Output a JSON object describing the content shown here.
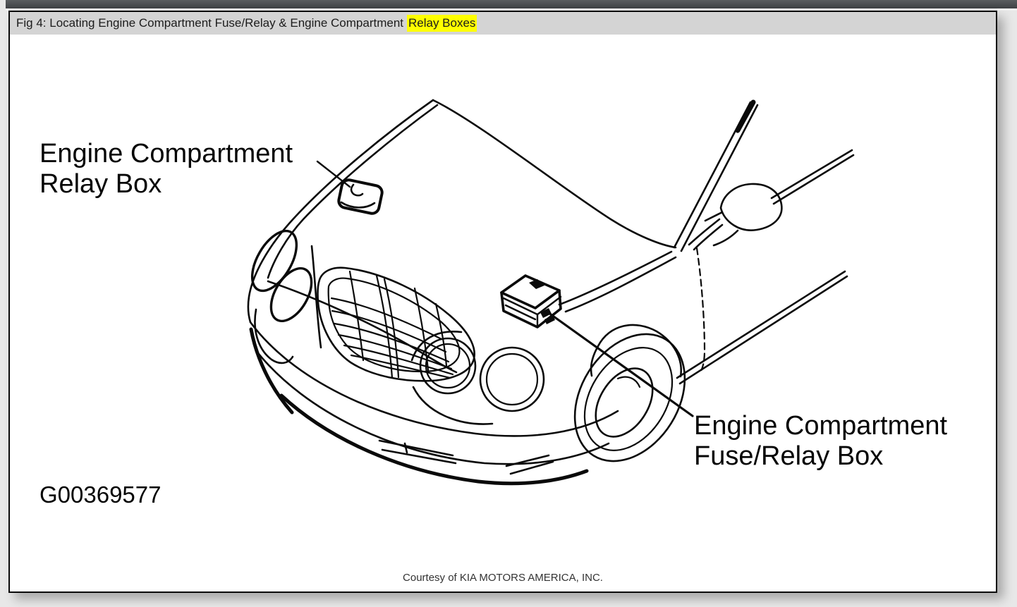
{
  "title_bar": {
    "prefix": "Fig 4: Locating Engine Compartment Fuse/Relay & Engine Compartment",
    "highlight": "Relay Boxes",
    "highlight_color": "#ffff00"
  },
  "figure": {
    "callouts": {
      "relay_box": {
        "line1": "Engine Compartment",
        "line2": "Relay Box"
      },
      "fuse_relay_box": {
        "line1": "Engine Compartment",
        "line2": "Fuse/Relay Box"
      }
    },
    "figure_id": "G00369577",
    "courtesy": "Courtesy of KIA MOTORS AMERICA, INC.",
    "ink_color": "#0a0a0a",
    "paper_color": "#ffffff"
  }
}
